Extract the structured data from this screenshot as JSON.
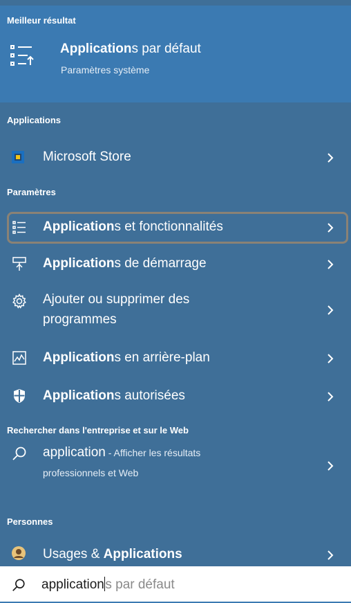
{
  "best": {
    "heading": "Meilleur résultat",
    "title_bold": "Application",
    "title_rest": "s par défaut",
    "subtitle": "Paramètres système"
  },
  "applications": {
    "heading": "Applications",
    "items": [
      {
        "label": "Microsoft Store"
      }
    ]
  },
  "parametres": {
    "heading": "Paramètres",
    "items": [
      {
        "bold": "Application",
        "rest": "s et fonctionnalités",
        "icon": "apps-features-icon"
      },
      {
        "bold": "Application",
        "rest": "s de démarrage",
        "icon": "startup-icon"
      },
      {
        "line1": "Ajouter ou supprimer des",
        "line2": "programmes",
        "icon": "gear-icon"
      },
      {
        "bold": "Application",
        "rest": "s en arrière-plan",
        "icon": "background-apps-icon"
      },
      {
        "bold": "Application",
        "rest": "s autorisées",
        "icon": "shield-icon"
      }
    ]
  },
  "web": {
    "heading": "Rechercher dans l'entreprise et sur le Web",
    "query": "application",
    "hint": " - Afficher les résultats",
    "hint_line2": "professionnels et Web"
  },
  "personnes": {
    "heading": "Personnes",
    "items": [
      {
        "regular": "Usages & ",
        "bold": "Applications"
      }
    ]
  },
  "search": {
    "typed": "application",
    "suggestion": "s par défaut"
  },
  "colors": {
    "panel": "#3f6f98",
    "best_highlight": "#3b7ab2",
    "selection_border": "#8a8275"
  }
}
